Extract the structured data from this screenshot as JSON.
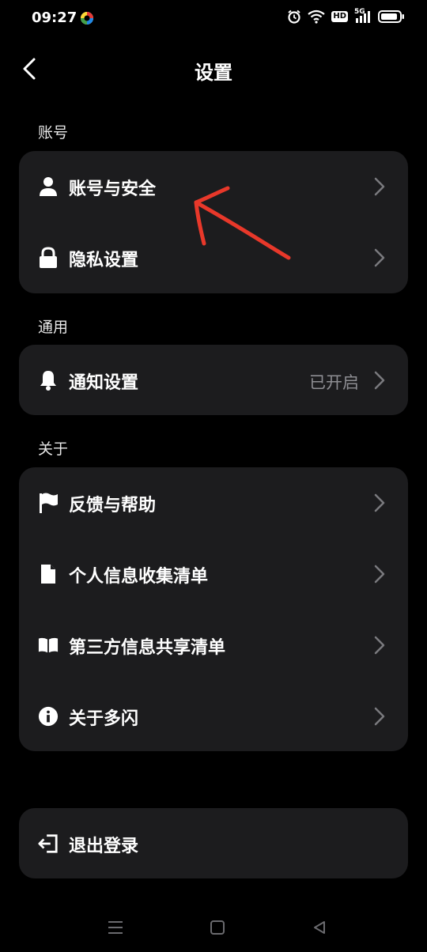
{
  "status_bar": {
    "time": "09:27",
    "icons": [
      "app-badge-icon",
      "alarm-icon",
      "wifi-icon",
      "hd-icon",
      "signal-5g-icon",
      "battery-icon"
    ],
    "hd": "HD",
    "network": "5G"
  },
  "header": {
    "title": "设置",
    "back_icon": "chevron-left-icon"
  },
  "sections": {
    "account": {
      "label": "账号",
      "items": [
        {
          "label": "账号与安全",
          "icon": "person-icon"
        },
        {
          "label": "隐私设置",
          "icon": "lock-icon"
        }
      ]
    },
    "general": {
      "label": "通用",
      "items": [
        {
          "label": "通知设置",
          "value": "已开启",
          "icon": "bell-icon"
        }
      ]
    },
    "about": {
      "label": "关于",
      "items": [
        {
          "label": "反馈与帮助",
          "icon": "flag-icon"
        },
        {
          "label": "个人信息收集清单",
          "icon": "document-icon"
        },
        {
          "label": "第三方信息共享清单",
          "icon": "book-icon"
        },
        {
          "label": "关于多闪",
          "icon": "info-icon"
        }
      ]
    }
  },
  "logout": {
    "label": "退出登录",
    "icon": "logout-icon"
  },
  "annotation": {
    "color": "#e8382a",
    "icon": "red-arrow-annotation"
  },
  "navigation_bar": {
    "icons": [
      "menu-icon",
      "home-icon",
      "back-triangle-icon"
    ]
  }
}
